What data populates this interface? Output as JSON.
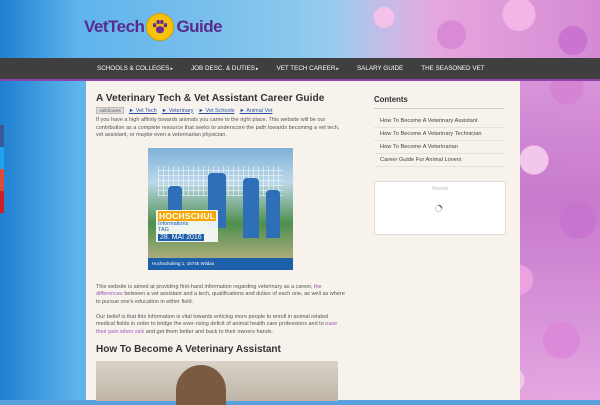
{
  "site": {
    "logo_left": "VetTech",
    "logo_right": "Guide"
  },
  "nav": {
    "items": [
      {
        "label": "SCHOOLS & COLLEGES",
        "has_dropdown": true
      },
      {
        "label": "JOB DESC. & DUTIES",
        "has_dropdown": true
      },
      {
        "label": "VET TECH CAREER",
        "has_dropdown": true
      },
      {
        "label": "SALARY GUIDE",
        "has_dropdown": false
      },
      {
        "label": "THE SEASONED VET",
        "has_dropdown": false
      }
    ]
  },
  "article": {
    "title": "A Veterinary Tech & Vet Assistant Career Guide",
    "ads": {
      "adchoices": "AdChoices",
      "links": [
        "► Vet Tech",
        "► Veterinary",
        "► Vet Schools",
        "► Animal Vet"
      ]
    },
    "intro": "If you have a high affinity towards animals you came to the right place. This website will be our contribution as a complete resource that seeks to underscore the path towards becoming a vet tech, vet assistant, or maybe even a veterinarian physician.",
    "image": {
      "banner_main": "HOCHSCHUL",
      "banner_sub": "Informations",
      "banner_tag": "TAG",
      "banner_date": "28. MAI 2016",
      "footer_text": "Hochschulring 1, 15745 Wildau"
    },
    "para2_before": "This website is aimed at providing first-hand information regarding veterinary as a career, ",
    "para2_link": "the differences",
    "para2_after": " between a vet assistant and a tech, qualifications and duties of each one, as well as where to pursue one's education in either field.",
    "para3_before": "Our belief is that this information is vital towards enticing more people to enroll in animal related medical fields in order to bridge the ever-rising deficit of animal health care professions and to ",
    "para3_link": "ease their pain when sick",
    "para3_after": " and get them better and back to their owners hands.",
    "subheading": "How To Become A Veterinary Assistant"
  },
  "sidebar": {
    "contents_title": "Contents",
    "contents_items": [
      "How To Become A Veterinary Assistant",
      "How To Become A Veterinary Technician",
      "How To Become A Veterinarian",
      "Career Guide For Animal Lovers"
    ],
    "widget_label": "Recent"
  },
  "colors": {
    "nav_bg": "#3f3f3f",
    "nav_border": "#8e44ad",
    "link_purple": "#9b59b6",
    "logo_purple": "#5a2a8c",
    "paw_yellow": "#f5c20b",
    "content_bg": "#f7f3ec"
  },
  "icons": {
    "logo_icon": "paw-icon",
    "loading_icon": "spinner-icon",
    "dropdown_icon": "dropdown-arrow-icon"
  }
}
